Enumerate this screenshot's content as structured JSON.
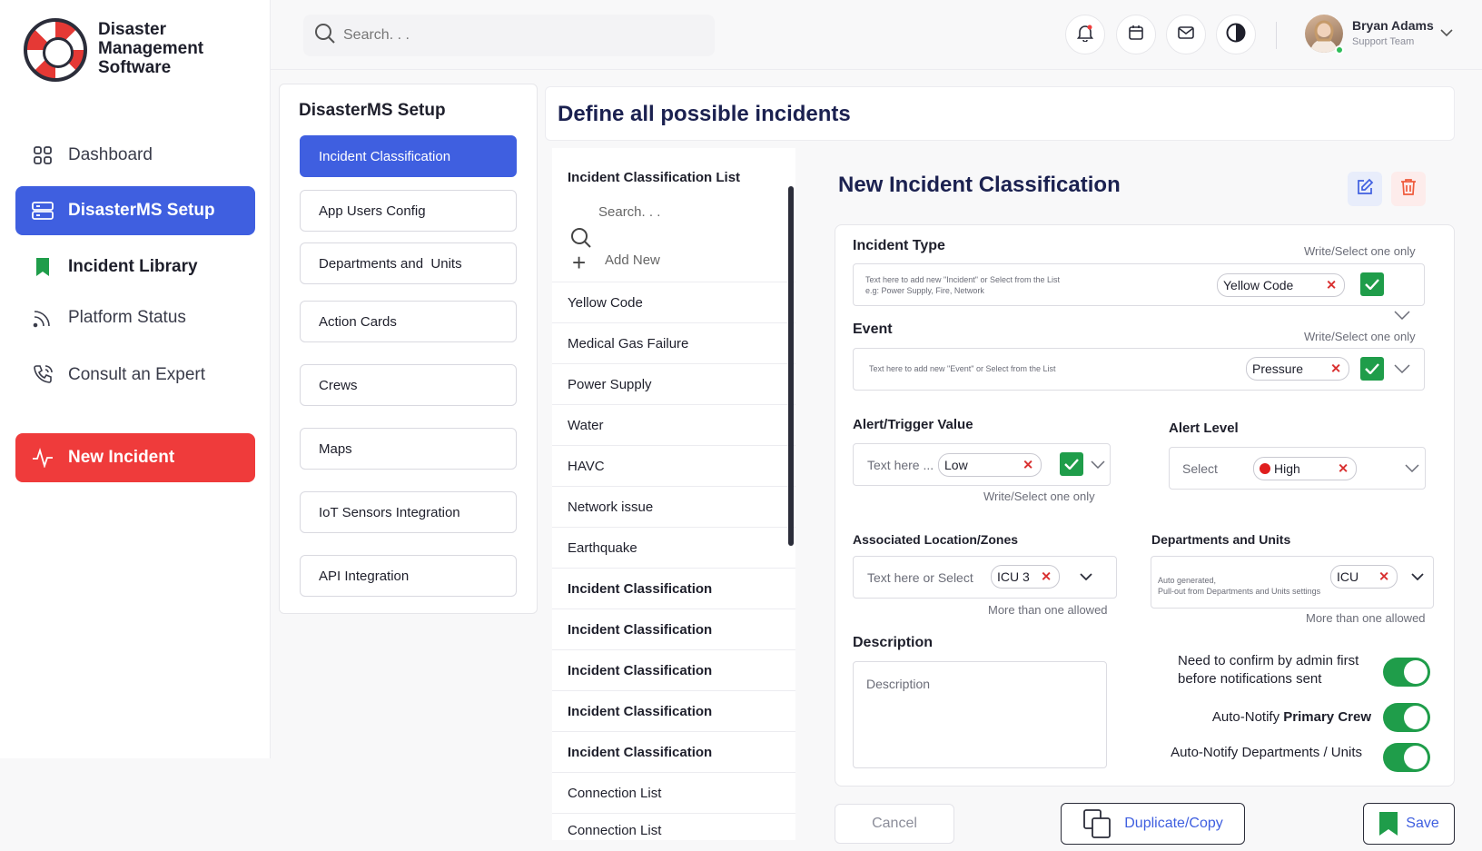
{
  "brand": {
    "line1": "Disaster",
    "line2": "Management",
    "line3": "Software"
  },
  "nav": [
    {
      "label": "Dashboard",
      "icon": "grid-icon"
    },
    {
      "label": "DisasterMS Setup",
      "icon": "server-icon",
      "active": true
    },
    {
      "label": "Incident Library",
      "icon": "bookmark-icon"
    },
    {
      "label": "Platform Status",
      "icon": "signal-icon"
    },
    {
      "label": "Consult an Expert",
      "icon": "phone-icon"
    },
    {
      "label": "New Incident",
      "icon": "pulse-icon"
    }
  ],
  "header": {
    "search_placeholder": "Search. . .",
    "user_name": "Bryan Adams",
    "user_role": "Support Team"
  },
  "setup": {
    "title": "DisasterMS Setup",
    "items": [
      "Incident Classification",
      "App Users Config",
      "Departments and  Units",
      "Action Cards",
      "Crews",
      "Maps",
      "IoT Sensors Integration",
      "API Integration"
    ]
  },
  "main_title": "Define all possible incidents",
  "list": {
    "title": "Incident Classification List",
    "search_placeholder": "Search. . .",
    "add_new": "Add New",
    "items": [
      "Yellow Code",
      "Medical Gas Failure",
      "Power Supply",
      "Water",
      "HAVC",
      "Network issue",
      "Earthquake",
      "Incident Classification",
      "Incident Classification",
      "Incident Classification",
      "Incident Classification",
      "Incident Classification",
      "Connection List",
      "Connection List"
    ]
  },
  "form": {
    "title": "New Incident Classification",
    "incident_type": {
      "label": "Incident Type",
      "hint": "Write/Select one only",
      "placeholder_line1": "Text here to add new \"Incident\" or Select from the List",
      "placeholder_line2": "e.g: Power Supply, Fire, Network",
      "chip": "Yellow Code"
    },
    "event": {
      "label": "Event",
      "hint": "Write/Select one only",
      "placeholder": "Text here to add new \"Event\" or Select from the List",
      "chip": "Pressure"
    },
    "alert_trigger": {
      "label": "Alert/Trigger Value",
      "placeholder": "Text here ...",
      "chip": "Low",
      "hint": "Write/Select one only"
    },
    "alert_level": {
      "label": "Alert Level",
      "placeholder": "Select",
      "chip": "High"
    },
    "location": {
      "label": "Associated Location/Zones",
      "placeholder": "Text here or Select",
      "chip": "ICU 3",
      "hint": "More than one allowed"
    },
    "departments": {
      "label": "Departments and Units",
      "auto_line1": "Auto generated,",
      "auto_line2": "Pull-out from Departments and Units settings",
      "chip": "ICU",
      "hint": "More than one allowed"
    },
    "description": {
      "label": "Description",
      "placeholder": "Description"
    },
    "toggles": {
      "confirm_line1": "Need to confirm by admin first",
      "confirm_line2": "before notifications sent",
      "notify_primary_pre": "Auto-Notify ",
      "notify_primary_bold": "Primary Crew",
      "notify_depts": "Auto-Notify Departments / Units"
    },
    "buttons": {
      "cancel": "Cancel",
      "duplicate": "Duplicate/Copy",
      "save": "Save"
    }
  },
  "colors": {
    "primary": "#3f5fe0",
    "danger": "#ef3b3b",
    "success": "#1f9d4a",
    "title": "#1b2150"
  }
}
